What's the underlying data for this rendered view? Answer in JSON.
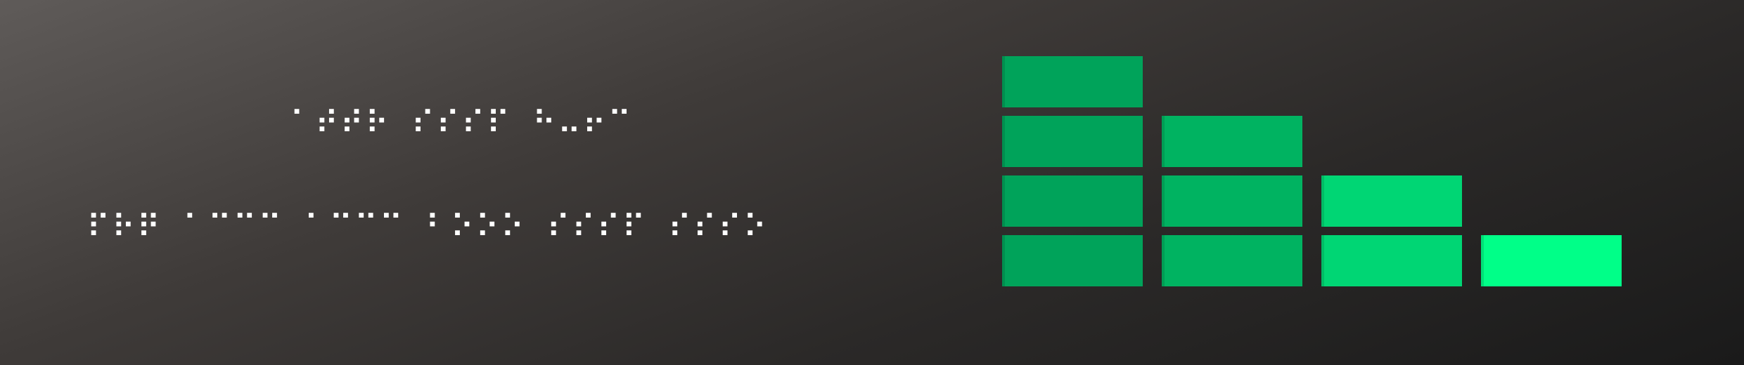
{
  "text": {
    "line1": "⠁⠞⠞⠗ ⠎⠎⠎⠏ ⠓⠤⠖⠉",
    "line2": "⠏⠗⠟ ⠁⠉⠉⠉ ⠁⠉⠉⠉ ⠃⠕⠕⠕ ⠎⠎⠎⠏ ⠎⠎⠎⠕"
  },
  "bar_stack": {
    "levels": [
      4,
      3,
      2,
      1
    ],
    "colors": [
      "#00a35a",
      "#00b361",
      "#00d674",
      "#00ff88"
    ]
  }
}
